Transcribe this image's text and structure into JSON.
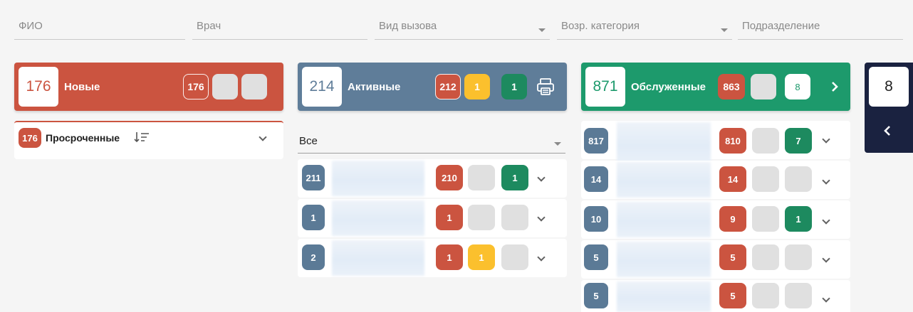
{
  "filters": [
    {
      "label": "ФИО",
      "dropdown": false
    },
    {
      "label": "Врач",
      "dropdown": false
    },
    {
      "label": "Вид вызова",
      "dropdown": true
    },
    {
      "label": "Возр. категория",
      "dropdown": true
    },
    {
      "label": "Подразделение",
      "dropdown": false
    }
  ],
  "columns": {
    "new": {
      "count": "176",
      "title": "Новые",
      "badge": "176",
      "color": "#cb5440",
      "overdue": {
        "count": "176",
        "label": "Просроченные",
        "sort_icon": "sort-icon"
      }
    },
    "active": {
      "count": "214",
      "title": "Активные",
      "color": "#5f7d99",
      "badges": [
        "212",
        "1",
        "1"
      ],
      "print_icon": "printer-icon",
      "select": {
        "value": "Все"
      },
      "rows": [
        {
          "count": "211",
          "red": "210",
          "yellow": "",
          "green": "1"
        },
        {
          "count": "1",
          "red": "1",
          "yellow": "",
          "green": ""
        },
        {
          "count": "2",
          "red": "1",
          "yellow": "1",
          "green": ""
        }
      ]
    },
    "served": {
      "count": "871",
      "title": "Обслуженные",
      "badge_red": "863",
      "badge_green": "8",
      "color": "#1d9a6c",
      "rows": [
        {
          "count": "817",
          "red": "810",
          "green": "7"
        },
        {
          "count": "14",
          "red": "14",
          "green": ""
        },
        {
          "count": "10",
          "red": "9",
          "green": "1"
        },
        {
          "count": "5",
          "red": "5",
          "green": ""
        },
        {
          "count": "5",
          "red": "5",
          "green": ""
        }
      ]
    },
    "collapsed": {
      "count": "8",
      "color": "#1a2240"
    }
  }
}
